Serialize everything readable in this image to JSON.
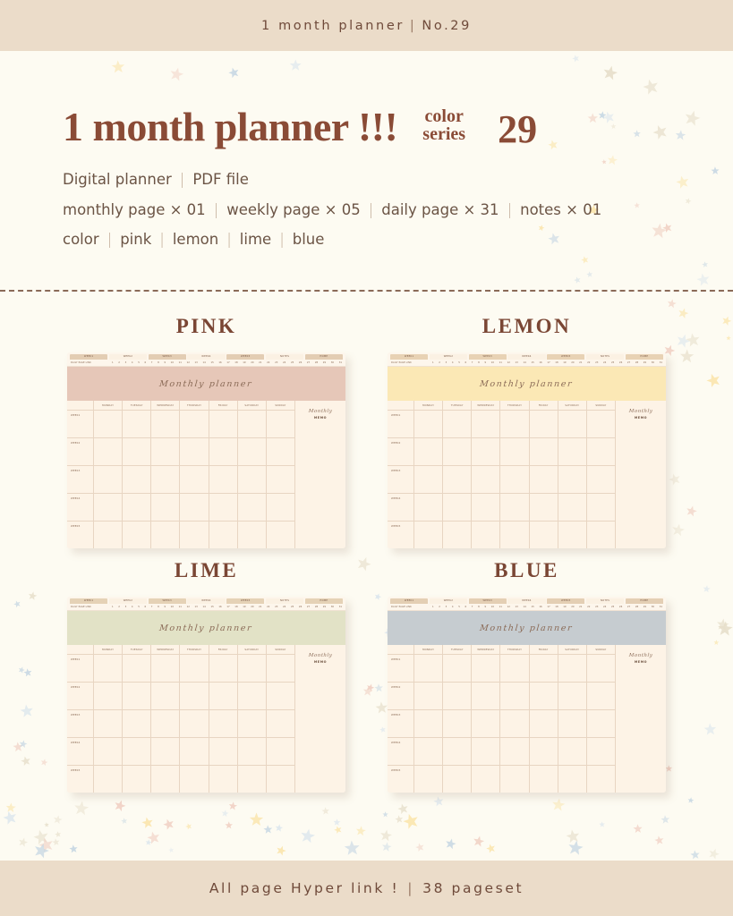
{
  "topbar": {
    "title": "1 month planner",
    "separator": "|",
    "number": "No.29"
  },
  "hero": {
    "title": "1 month planner !!!",
    "color_word": "color",
    "series_word": "series",
    "series_number": "29",
    "lines": [
      {
        "parts": [
          "Digital planner",
          "PDF file"
        ]
      },
      {
        "parts": [
          "monthly page × 01",
          "weekly page × 05",
          "daily page × 31",
          "notes × 01"
        ]
      },
      {
        "parts": [
          "color",
          "pink",
          "lemon",
          "lime",
          "blue"
        ]
      }
    ],
    "separator": "|"
  },
  "footer": {
    "text_left": "All page Hyper link !",
    "separator": "|",
    "text_right": "38 pageset"
  },
  "planner_common": {
    "tabs": [
      "WEEK1",
      "WEEK2",
      "WEEK3",
      "WEEK4",
      "WEEK5",
      "NOTES",
      "HOME"
    ],
    "tab_active_flags": [
      true,
      false,
      true,
      false,
      true,
      false,
      true
    ],
    "daily_label": "DAILY PAGE LINK",
    "daily_numbers": [
      "1",
      "2",
      "3",
      "4",
      "5",
      "6",
      "7",
      "8",
      "9",
      "10",
      "11",
      "12",
      "13",
      "14",
      "15",
      "16",
      "17",
      "18",
      "19",
      "20",
      "21",
      "22",
      "23",
      "24",
      "25",
      "26",
      "27",
      "28",
      "29",
      "30",
      "31"
    ],
    "band_title": "Monthly planner",
    "days_of_week": [
      "MONDAY",
      "TUESDAY",
      "WEDNESDAY",
      "THURSDAY",
      "FRIDAY",
      "SATURDAY",
      "SUNDAY"
    ],
    "week_labels": [
      "WEEK1",
      "WEEK2",
      "WEEK3",
      "WEEK4",
      "WEEK5"
    ],
    "memo_script": "Monthly",
    "memo_word": "MEMO"
  },
  "previews": [
    {
      "label": "PINK",
      "band_color": "#e6c7b8",
      "tab_color": "#e3cdb3"
    },
    {
      "label": "LEMON",
      "band_color": "#fbe8b5",
      "tab_color": "#e8d2b4"
    },
    {
      "label": "LIME",
      "band_color": "#e2e2c6",
      "tab_color": "#e5d2b6"
    },
    {
      "label": "BLUE",
      "band_color": "#c6ccd0",
      "tab_color": "#e4cfb4"
    }
  ],
  "palette": {
    "page_bg": "#fdfbf2",
    "band_bg": "#ebdcc9",
    "ink": "#6f4a3a",
    "title_ink": "#8a4b36",
    "divider": "#8a6a58",
    "paper": "#fdf3e6",
    "star_yellow": "#fbe6ae",
    "star_blue": "#c8d8e4",
    "star_pink": "#f0cdc0"
  }
}
